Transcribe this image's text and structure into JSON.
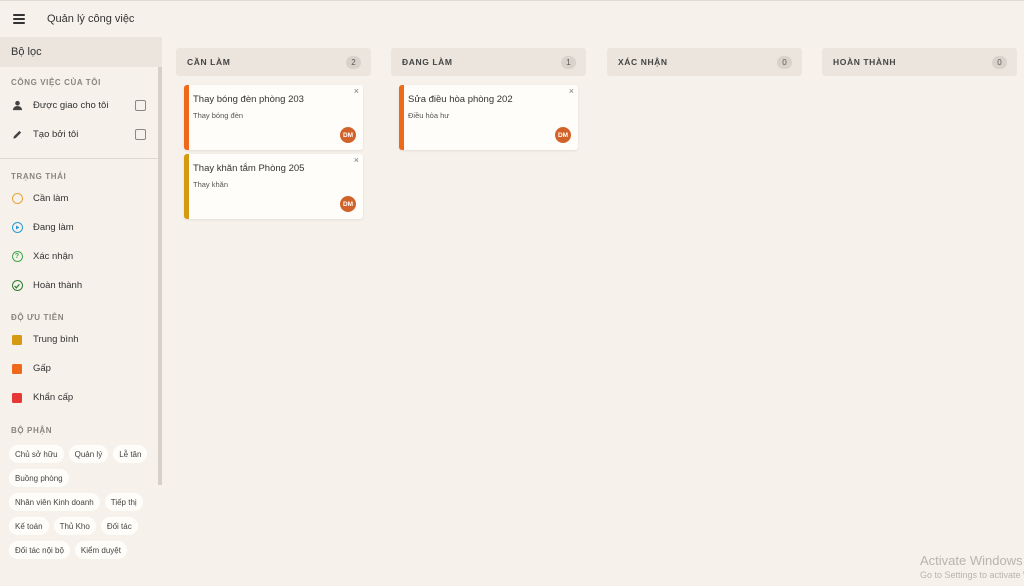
{
  "app": {
    "title": "Quản lý công việc"
  },
  "sidebar": {
    "filter_title": "Bộ lọc",
    "my_tasks": {
      "title": "CÔNG VIỆC CỦA TÔI",
      "items": [
        {
          "label": "Được giao cho tôi",
          "icon": "person-icon"
        },
        {
          "label": "Tạo bởi tôi",
          "icon": "pencil-icon"
        }
      ]
    },
    "status": {
      "title": "TRẠNG THÁI",
      "items": [
        {
          "label": "Cần làm",
          "icon": "circle-outline-icon",
          "color": "#e8a43a"
        },
        {
          "label": "Đang làm",
          "icon": "play-circle-icon",
          "color": "#2a9bd6"
        },
        {
          "label": "Xác nhận",
          "icon": "help-circle-icon",
          "color": "#3aa84a"
        },
        {
          "label": "Hoàn thành",
          "icon": "check-circle-icon",
          "color": "#2e7d32"
        }
      ]
    },
    "priority": {
      "title": "ĐỘ ƯU TIÊN",
      "items": [
        {
          "label": "Trung bình",
          "color": "#d69a12"
        },
        {
          "label": "Gấp",
          "color": "#ee6a1a"
        },
        {
          "label": "Khẩn cấp",
          "color": "#e53935"
        }
      ]
    },
    "department": {
      "title": "BỘ PHẬN",
      "chips": [
        "Chủ sở hữu",
        "Quản lý",
        "Lễ tân",
        "Buồng phòng",
        "Nhân viên Kinh doanh",
        "Tiếp thị",
        "Kế toán",
        "Thủ Kho",
        "Đối tác",
        "Đối tác nội bộ",
        "Kiểm duyệt"
      ]
    }
  },
  "board": {
    "columns": [
      {
        "title": "CẦN LÀM",
        "count": "2",
        "cards": [
          {
            "title": "Thay bóng đèn phòng 203",
            "desc": "Thay bóng đèn",
            "avatar": "DM",
            "color": "#ee6a1a"
          },
          {
            "title": "Thay khăn tắm Phòng 205",
            "desc": "Thay khăn",
            "avatar": "DM",
            "color": "#d69a12"
          }
        ]
      },
      {
        "title": "ĐANG LÀM",
        "count": "1",
        "cards": [
          {
            "title": "Sửa điều hòa phòng 202",
            "desc": "Điều hòa hư",
            "avatar": "DM",
            "color": "#ee6a1a"
          }
        ]
      },
      {
        "title": "XÁC NHẬN",
        "count": "0",
        "cards": []
      },
      {
        "title": "HOÀN THÀNH",
        "count": "0",
        "cards": []
      }
    ]
  },
  "watermark": {
    "line1": "Activate Windows",
    "line2": "Go to Settings to activate Windows."
  }
}
